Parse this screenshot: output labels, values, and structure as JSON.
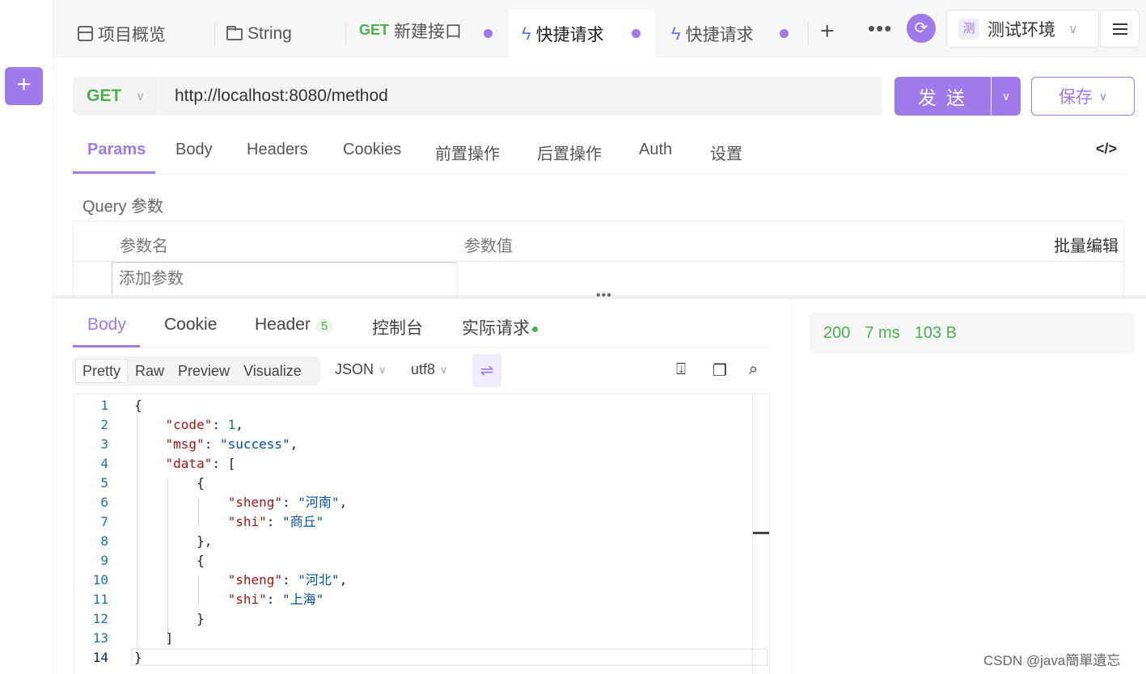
{
  "rail": {
    "add_label": "+"
  },
  "tabs": [
    {
      "label": "项目概览",
      "icon": "overview-icon"
    },
    {
      "label": "String",
      "icon": "folder-icon"
    },
    {
      "method": "GET",
      "label": "新建接口",
      "unsaved": true
    },
    {
      "label": "快捷请求",
      "icon": "bolt-icon",
      "unsaved": true,
      "active": true
    },
    {
      "label": "快捷请求",
      "icon": "bolt-icon",
      "unsaved": true
    }
  ],
  "tabbar": {
    "add": "+",
    "more": "•••"
  },
  "environment": {
    "tag": "测",
    "name": "测试环境"
  },
  "request": {
    "method": "GET",
    "url": "http://localhost:8080/method",
    "send_label": "发 送",
    "save_label": "保存"
  },
  "request_tabs": [
    "Params",
    "Body",
    "Headers",
    "Cookies",
    "前置操作",
    "后置操作",
    "Auth",
    "设置"
  ],
  "query": {
    "title": "Query 参数",
    "col_name": "参数名",
    "col_value": "参数值",
    "bulk_edit": "批量编辑",
    "add_placeholder": "添加参数"
  },
  "response_tabs": {
    "body": "Body",
    "cookie": "Cookie",
    "header": "Header",
    "header_count": "5",
    "console": "控制台",
    "actual": "实际请求"
  },
  "format": {
    "modes": [
      "Pretty",
      "Raw",
      "Preview",
      "Visualize"
    ],
    "type": "JSON",
    "encoding": "utf8"
  },
  "status": {
    "code": "200",
    "time": "7 ms",
    "size": "103 B"
  },
  "body_lines": [
    "{",
    "    \"code\": 1,",
    "    \"msg\": \"success\",",
    "    \"data\": [",
    "        {",
    "            \"sheng\": \"河南\",",
    "            \"shi\": \"商丘\"",
    "        },",
    "        {",
    "            \"sheng\": \"河北\",",
    "            \"shi\": \"上海\"",
    "        }",
    "    ]",
    "}"
  ],
  "watermark": "CSDN @java簡單遺忘"
}
